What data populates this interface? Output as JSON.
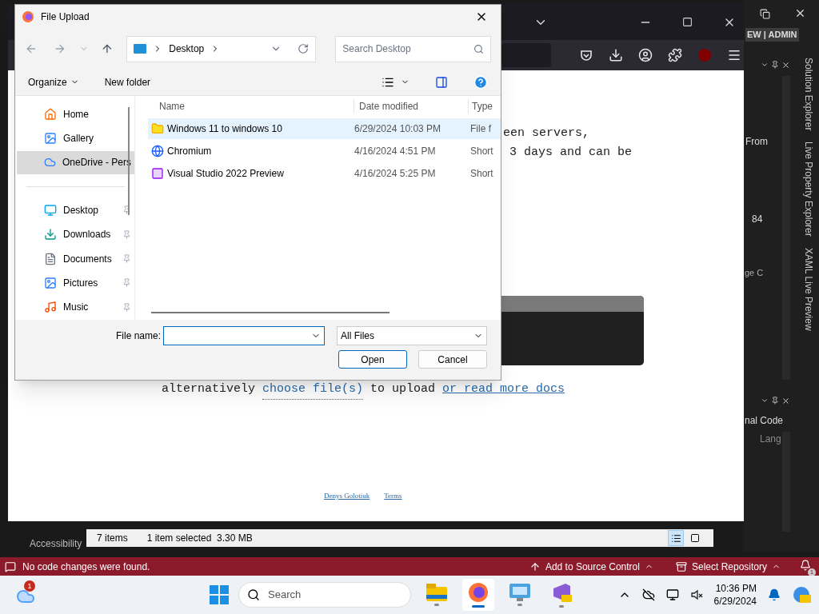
{
  "ide": {
    "title_tail": "EW | ADMIN",
    "side_tabs": [
      "Solution Explorer",
      "Live Property Explorer",
      "XAML Live Preview"
    ],
    "panel_texts": [
      "From",
      "84"
    ],
    "tab_fragments": [
      "ge",
      "C"
    ],
    "lower_row": "nal Code",
    "lower_header": "Lang",
    "bottom_left": "Accessibility"
  },
  "explorer_status": {
    "items": "7 items",
    "selection": "1 item selected  3.30 MB",
    "views": [
      {
        "kind": "details",
        "selected": true
      },
      {
        "kind": "tiles",
        "selected": false
      }
    ]
  },
  "browser": {
    "page_lines": [
      "een servers,",
      "3 days and can be"
    ],
    "upload_line": {
      "lead": "alternatively",
      "choose_link": "choose file(s)",
      "middle": "to upload",
      "docs_link": "or read more docs"
    },
    "footer_links": [
      "Denys Golotiuk",
      "Terms"
    ]
  },
  "dialog": {
    "title": "File Upload",
    "address": "Desktop",
    "search_placeholder": "Search Desktop",
    "commands": [
      "Organize",
      "New folder"
    ],
    "nav": [
      {
        "label": "Home",
        "kind": "home",
        "selected": false
      },
      {
        "label": "Gallery",
        "kind": "gallery",
        "selected": false
      },
      {
        "label": "OneDrive - Pers",
        "kind": "cloud",
        "selected": true
      },
      {
        "label": "Desktop",
        "kind": "desktop",
        "selected": false
      },
      {
        "label": "Downloads",
        "kind": "downloads",
        "selected": false
      },
      {
        "label": "Documents",
        "kind": "documents",
        "selected": false
      },
      {
        "label": "Pictures",
        "kind": "pictures",
        "selected": false
      },
      {
        "label": "Music",
        "kind": "music",
        "selected": false
      }
    ],
    "columns": [
      "Name",
      "Date modified",
      "Type"
    ],
    "files": [
      {
        "name": "Windows 11 to windows 10",
        "date": "6/29/2024 10:03 PM",
        "type": "File f",
        "kind": "folder",
        "selected": true
      },
      {
        "name": "Chromium",
        "date": "4/16/2024 4:51 PM",
        "type": "Short",
        "kind": "shortcut",
        "selected": false
      },
      {
        "name": "Visual Studio 2022 Preview",
        "date": "4/16/2024 5:25 PM",
        "type": "Short",
        "kind": "vs",
        "selected": false
      }
    ],
    "file_name_label": "File name:",
    "filter": "All Files",
    "buttons": [
      "Open",
      "Cancel"
    ]
  },
  "status_bar": {
    "message": "No code changes were found.",
    "actions": [
      "Add to Source Control",
      "Select Repository"
    ],
    "badge": "1"
  },
  "taskbar": {
    "widget_badge": "1",
    "search_placeholder": "Search",
    "apps": [
      {
        "kind": "explorer",
        "selected": false
      },
      {
        "kind": "firefox",
        "selected": true
      },
      {
        "kind": "control",
        "selected": false
      },
      {
        "kind": "vs",
        "selected": false
      }
    ],
    "time": "10:36 PM",
    "date": "6/29/2024"
  }
}
